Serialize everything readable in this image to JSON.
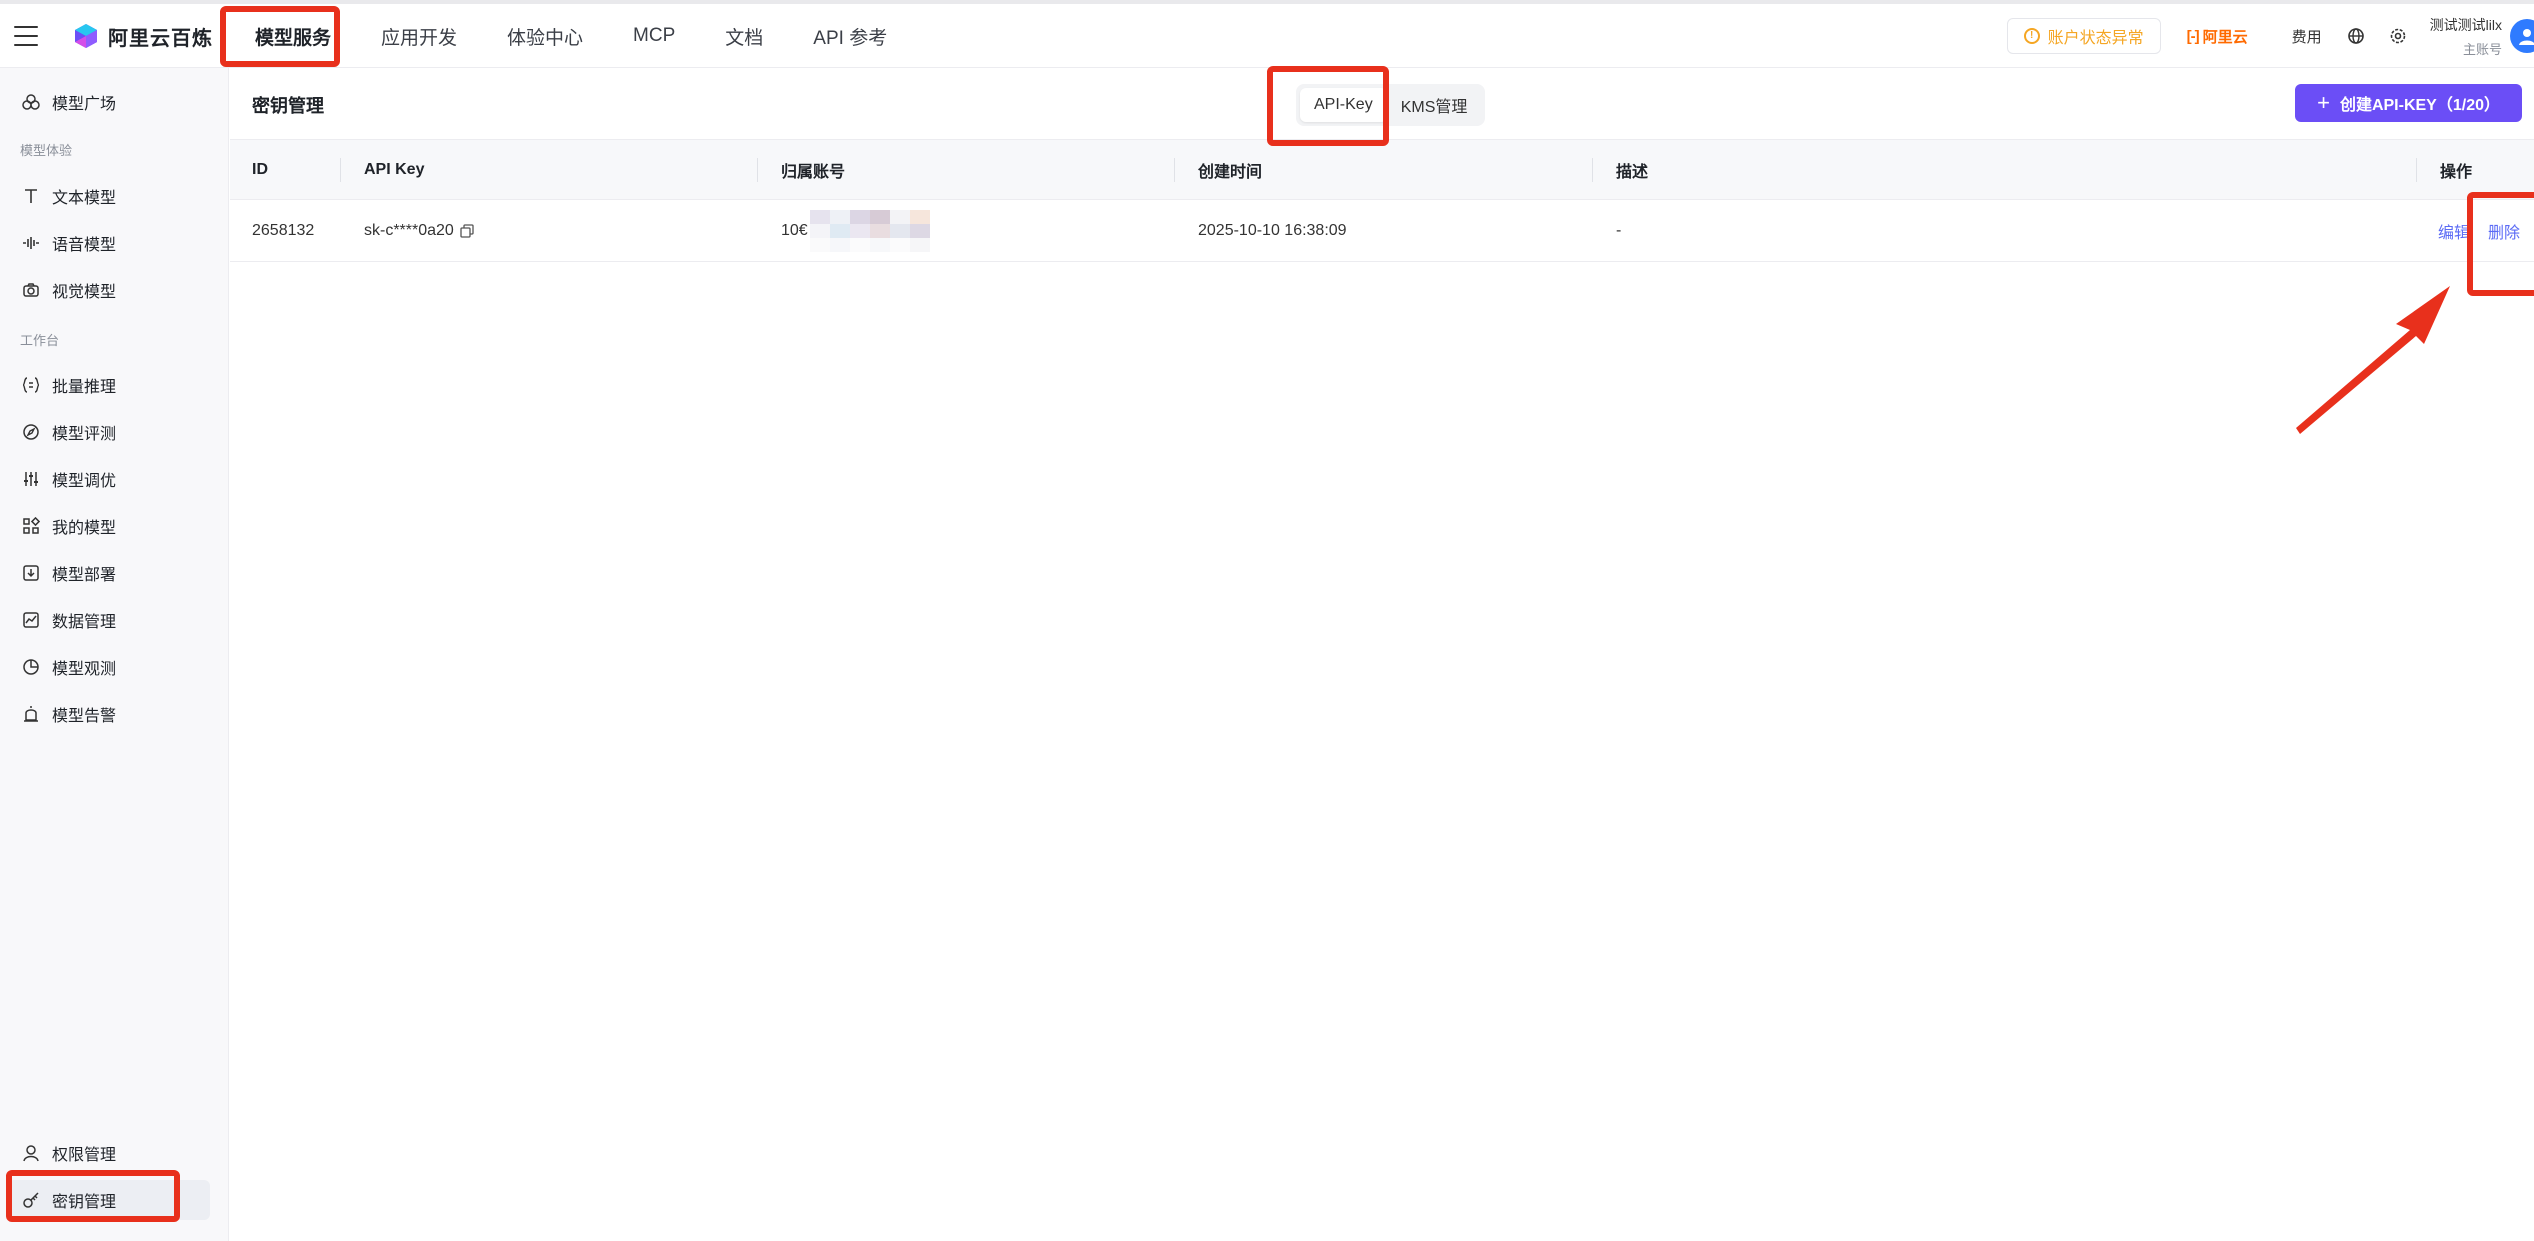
{
  "app": {
    "name": "阿里云百炼"
  },
  "nav": {
    "items": [
      {
        "label": "模型服务",
        "active": true
      },
      {
        "label": "应用开发"
      },
      {
        "label": "体验中心"
      },
      {
        "label": "MCP"
      },
      {
        "label": "文档"
      },
      {
        "label": "API 参考"
      }
    ]
  },
  "top_right": {
    "alert": "账户状态异常",
    "aliyun": "阿里云",
    "fee": "费用",
    "user_name": "测试测试lilx",
    "user_role": "主账号",
    "icons": [
      "globe-icon",
      "gear-icon",
      "avatar"
    ]
  },
  "sidebar": {
    "top_item": "模型广场",
    "group1": "模型体验",
    "group1_items": [
      "文本模型",
      "语音模型",
      "视觉模型"
    ],
    "group2": "工作台",
    "group2_items": [
      "批量推理",
      "模型评测",
      "模型调优",
      "我的模型",
      "模型部署",
      "数据管理",
      "模型观测",
      "模型告警"
    ],
    "bottom_items": [
      "权限管理",
      "密钥管理"
    ]
  },
  "page": {
    "title": "密钥管理",
    "tabs": [
      "API-Key",
      "KMS管理"
    ],
    "create_button": "创建API-KEY（1/20）"
  },
  "table": {
    "headers": [
      "ID",
      "API Key",
      "归属账号",
      "创建时间",
      "描述",
      "操作"
    ],
    "rows": [
      {
        "id": "2658132",
        "api_key": "sk-c****0a20",
        "account": "10€",
        "created": "2025-10-10 16:38:09",
        "desc": "-",
        "actions": [
          "编辑",
          "删除"
        ]
      }
    ]
  },
  "colors": {
    "accent": "#6b4ef6",
    "link": "#5b6bf5",
    "annotation": "#e8301c",
    "warning": "#f5a623",
    "aliyun": "#ff6a00"
  }
}
